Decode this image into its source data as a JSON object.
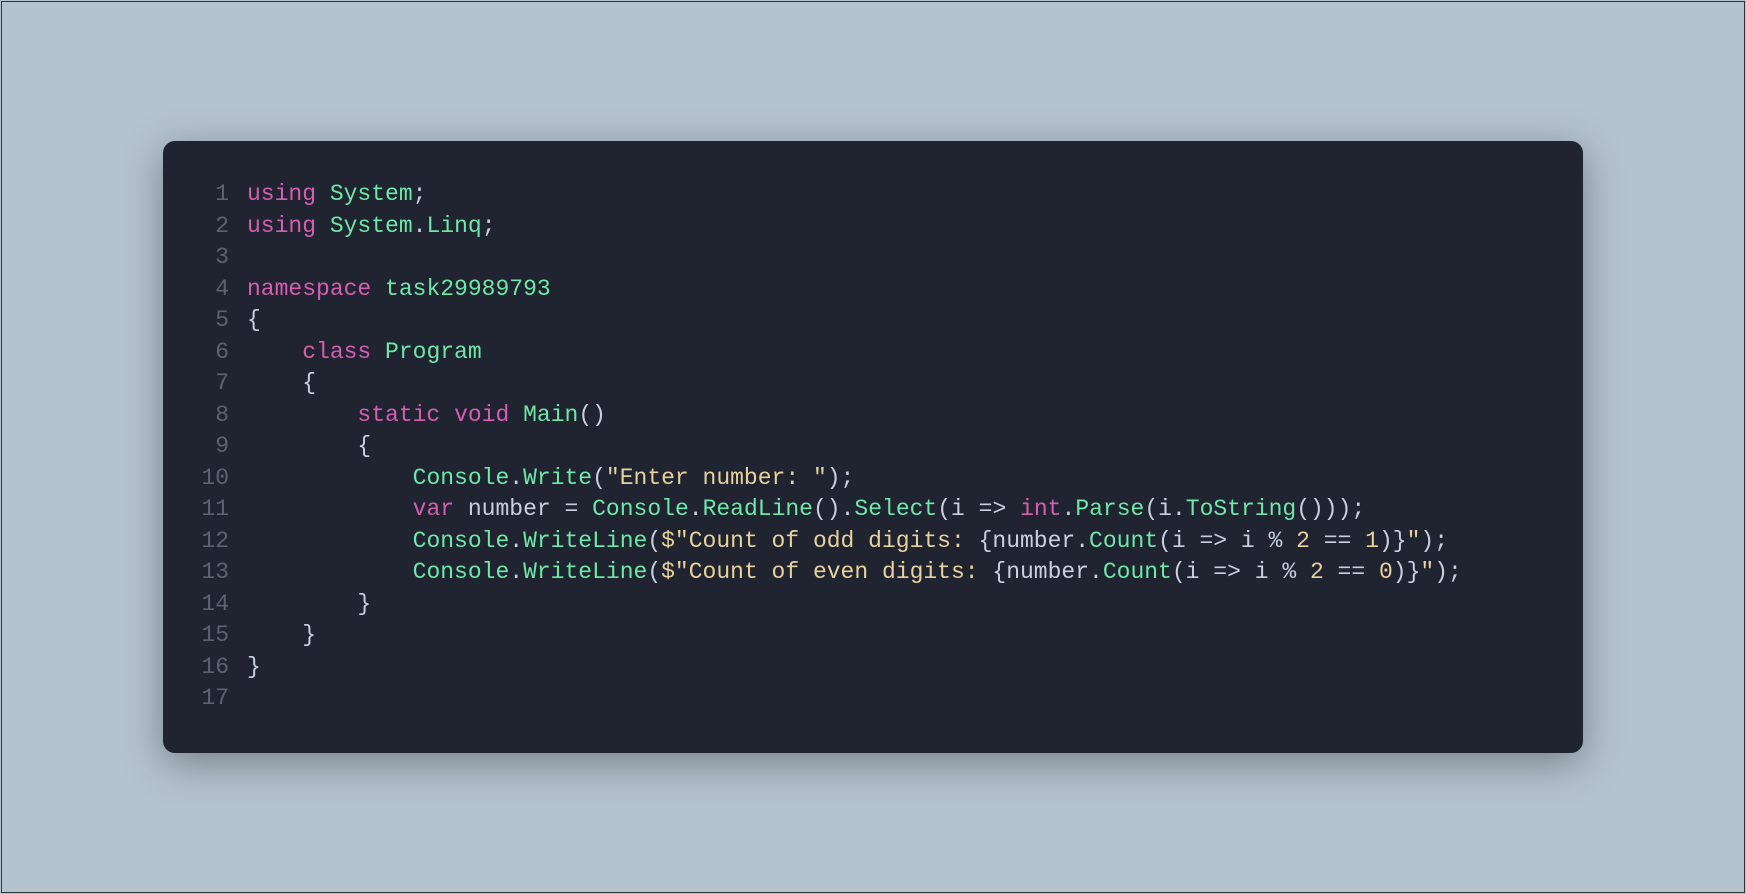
{
  "code": {
    "language": "csharp",
    "line_numbers": [
      "1",
      "2",
      "3",
      "4",
      "5",
      "6",
      "7",
      "8",
      "9",
      "10",
      "11",
      "12",
      "13",
      "14",
      "15",
      "16",
      "17"
    ],
    "lines": [
      [
        {
          "cls": "kw",
          "t": "using"
        },
        {
          "cls": "punct",
          "t": " "
        },
        {
          "cls": "type",
          "t": "System"
        },
        {
          "cls": "punct",
          "t": ";"
        }
      ],
      [
        {
          "cls": "kw",
          "t": "using"
        },
        {
          "cls": "punct",
          "t": " "
        },
        {
          "cls": "type",
          "t": "System"
        },
        {
          "cls": "punct",
          "t": "."
        },
        {
          "cls": "type",
          "t": "Linq"
        },
        {
          "cls": "punct",
          "t": ";"
        }
      ],
      [],
      [
        {
          "cls": "kw",
          "t": "namespace"
        },
        {
          "cls": "punct",
          "t": " "
        },
        {
          "cls": "type",
          "t": "task29989793"
        }
      ],
      [
        {
          "cls": "punct",
          "t": "{"
        }
      ],
      [
        {
          "cls": "punct",
          "t": "    "
        },
        {
          "cls": "kw",
          "t": "class"
        },
        {
          "cls": "punct",
          "t": " "
        },
        {
          "cls": "type",
          "t": "Program"
        }
      ],
      [
        {
          "cls": "punct",
          "t": "    {"
        }
      ],
      [
        {
          "cls": "punct",
          "t": "        "
        },
        {
          "cls": "kw",
          "t": "static"
        },
        {
          "cls": "punct",
          "t": " "
        },
        {
          "cls": "kw",
          "t": "void"
        },
        {
          "cls": "punct",
          "t": " "
        },
        {
          "cls": "type",
          "t": "Main"
        },
        {
          "cls": "punct",
          "t": "()"
        }
      ],
      [
        {
          "cls": "punct",
          "t": "        {"
        }
      ],
      [
        {
          "cls": "punct",
          "t": "            "
        },
        {
          "cls": "type",
          "t": "Console"
        },
        {
          "cls": "punct",
          "t": "."
        },
        {
          "cls": "type",
          "t": "Write"
        },
        {
          "cls": "punct",
          "t": "("
        },
        {
          "cls": "str",
          "t": "\"Enter number: \""
        },
        {
          "cls": "punct",
          "t": ");"
        }
      ],
      [
        {
          "cls": "punct",
          "t": "            "
        },
        {
          "cls": "kw",
          "t": "var"
        },
        {
          "cls": "punct",
          "t": " "
        },
        {
          "cls": "ident",
          "t": "number"
        },
        {
          "cls": "punct",
          "t": " = "
        },
        {
          "cls": "type",
          "t": "Console"
        },
        {
          "cls": "punct",
          "t": "."
        },
        {
          "cls": "type",
          "t": "ReadLine"
        },
        {
          "cls": "punct",
          "t": "()."
        },
        {
          "cls": "type",
          "t": "Select"
        },
        {
          "cls": "punct",
          "t": "("
        },
        {
          "cls": "ident",
          "t": "i"
        },
        {
          "cls": "punct",
          "t": " => "
        },
        {
          "cls": "kw",
          "t": "int"
        },
        {
          "cls": "punct",
          "t": "."
        },
        {
          "cls": "type",
          "t": "Parse"
        },
        {
          "cls": "punct",
          "t": "("
        },
        {
          "cls": "ident",
          "t": "i"
        },
        {
          "cls": "punct",
          "t": "."
        },
        {
          "cls": "type",
          "t": "ToString"
        },
        {
          "cls": "punct",
          "t": "()));"
        }
      ],
      [
        {
          "cls": "punct",
          "t": "            "
        },
        {
          "cls": "type",
          "t": "Console"
        },
        {
          "cls": "punct",
          "t": "."
        },
        {
          "cls": "type",
          "t": "WriteLine"
        },
        {
          "cls": "punct",
          "t": "("
        },
        {
          "cls": "str",
          "t": "$\"Count of odd digits: "
        },
        {
          "cls": "punct",
          "t": "{"
        },
        {
          "cls": "ident",
          "t": "number"
        },
        {
          "cls": "punct",
          "t": "."
        },
        {
          "cls": "type",
          "t": "Count"
        },
        {
          "cls": "punct",
          "t": "("
        },
        {
          "cls": "ident",
          "t": "i"
        },
        {
          "cls": "punct",
          "t": " => "
        },
        {
          "cls": "ident",
          "t": "i"
        },
        {
          "cls": "punct",
          "t": " % "
        },
        {
          "cls": "num",
          "t": "2"
        },
        {
          "cls": "punct",
          "t": " == "
        },
        {
          "cls": "num",
          "t": "1"
        },
        {
          "cls": "punct",
          "t": ")}"
        },
        {
          "cls": "str",
          "t": "\""
        },
        {
          "cls": "punct",
          "t": ");"
        }
      ],
      [
        {
          "cls": "punct",
          "t": "            "
        },
        {
          "cls": "type",
          "t": "Console"
        },
        {
          "cls": "punct",
          "t": "."
        },
        {
          "cls": "type",
          "t": "WriteLine"
        },
        {
          "cls": "punct",
          "t": "("
        },
        {
          "cls": "str",
          "t": "$\"Count of even digits: "
        },
        {
          "cls": "punct",
          "t": "{"
        },
        {
          "cls": "ident",
          "t": "number"
        },
        {
          "cls": "punct",
          "t": "."
        },
        {
          "cls": "type",
          "t": "Count"
        },
        {
          "cls": "punct",
          "t": "("
        },
        {
          "cls": "ident",
          "t": "i"
        },
        {
          "cls": "punct",
          "t": " => "
        },
        {
          "cls": "ident",
          "t": "i"
        },
        {
          "cls": "punct",
          "t": " % "
        },
        {
          "cls": "num",
          "t": "2"
        },
        {
          "cls": "punct",
          "t": " == "
        },
        {
          "cls": "num",
          "t": "0"
        },
        {
          "cls": "punct",
          "t": ")}"
        },
        {
          "cls": "str",
          "t": "\""
        },
        {
          "cls": "punct",
          "t": ");"
        }
      ],
      [
        {
          "cls": "punct",
          "t": "        }"
        }
      ],
      [
        {
          "cls": "punct",
          "t": "    }"
        }
      ],
      [
        {
          "cls": "punct",
          "t": "}"
        }
      ],
      []
    ]
  }
}
